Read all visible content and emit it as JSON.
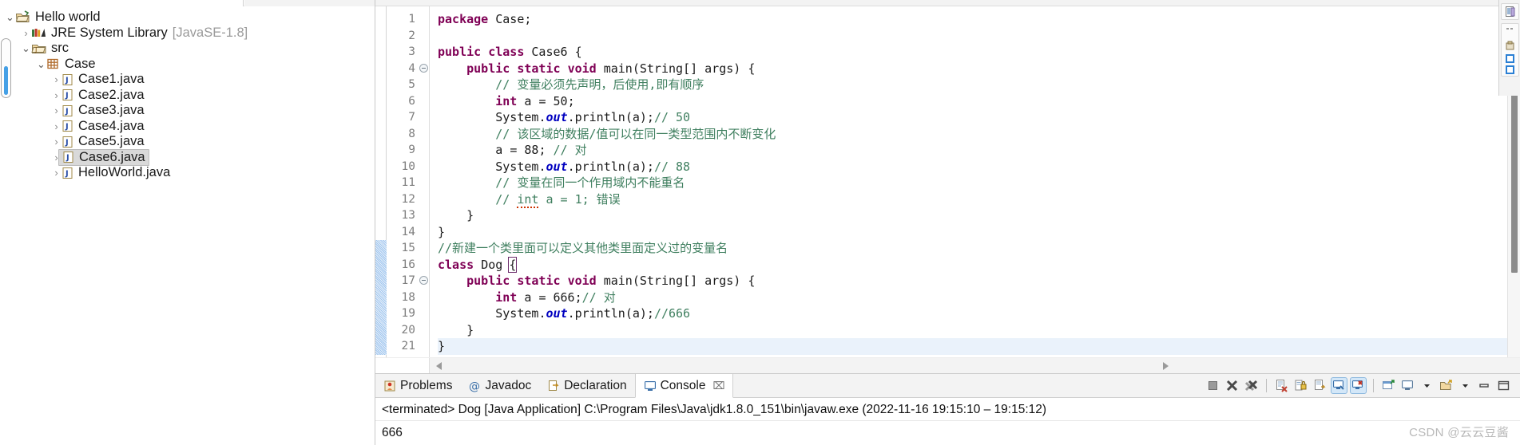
{
  "explorer": {
    "name": "package-explorer",
    "tree": [
      {
        "label": "Hello world",
        "icon": "project-open-icon",
        "arrow": "v",
        "indent": 0,
        "selected": false,
        "suffix": ""
      },
      {
        "label": "JRE System Library",
        "icon": "library-icon",
        "arrow": ">",
        "indent": 1,
        "selected": false,
        "suffix": "[JavaSE-1.8]"
      },
      {
        "label": "src",
        "icon": "source-folder-icon",
        "arrow": "v",
        "indent": 1,
        "selected": false,
        "suffix": ""
      },
      {
        "label": "Case",
        "icon": "package-icon",
        "arrow": "v",
        "indent": 2,
        "selected": false,
        "suffix": ""
      },
      {
        "label": "Case1.java",
        "icon": "java-file-icon",
        "arrow": ">",
        "indent": 3,
        "selected": false,
        "suffix": ""
      },
      {
        "label": "Case2.java",
        "icon": "java-file-icon",
        "arrow": ">",
        "indent": 3,
        "selected": false,
        "suffix": ""
      },
      {
        "label": "Case3.java",
        "icon": "java-file-icon",
        "arrow": ">",
        "indent": 3,
        "selected": false,
        "suffix": ""
      },
      {
        "label": "Case4.java",
        "icon": "java-file-icon",
        "arrow": ">",
        "indent": 3,
        "selected": false,
        "suffix": ""
      },
      {
        "label": "Case5.java",
        "icon": "java-file-icon",
        "arrow": ">",
        "indent": 3,
        "selected": false,
        "suffix": ""
      },
      {
        "label": "Case6.java",
        "icon": "java-file-icon",
        "arrow": ">",
        "indent": 3,
        "selected": true,
        "suffix": ""
      },
      {
        "label": "HelloWorld.java",
        "icon": "java-file-icon",
        "arrow": ">",
        "indent": 3,
        "selected": false,
        "suffix": ""
      }
    ]
  },
  "editor": {
    "name": "java-editor",
    "first_line": 1,
    "last_line": 21,
    "selection_block": {
      "from": 15,
      "to": 21
    },
    "lines": [
      {
        "n": 1,
        "fold": false,
        "hl": false,
        "text": "package Case;"
      },
      {
        "n": 2,
        "fold": false,
        "hl": false,
        "text": ""
      },
      {
        "n": 3,
        "fold": false,
        "hl": false,
        "text": "public class Case6 {"
      },
      {
        "n": 4,
        "fold": true,
        "hl": false,
        "text": "    public static void main(String[] args) {"
      },
      {
        "n": 5,
        "fold": false,
        "hl": false,
        "text": "        // 变量必须先声明，后使用,即有顺序"
      },
      {
        "n": 6,
        "fold": false,
        "hl": false,
        "text": "        int a = 50;"
      },
      {
        "n": 7,
        "fold": false,
        "hl": false,
        "text": "        System.out.println(a);// 50"
      },
      {
        "n": 8,
        "fold": false,
        "hl": false,
        "text": "        // 该区域的数据/值可以在同一类型范围内不断变化"
      },
      {
        "n": 9,
        "fold": false,
        "hl": false,
        "text": "        a = 88; // 对"
      },
      {
        "n": 10,
        "fold": false,
        "hl": false,
        "text": "        System.out.println(a);// 88"
      },
      {
        "n": 11,
        "fold": false,
        "hl": false,
        "text": "        // 变量在同一个作用域内不能重名"
      },
      {
        "n": 12,
        "fold": false,
        "hl": false,
        "text": "        // int a = 1; 错误"
      },
      {
        "n": 13,
        "fold": false,
        "hl": false,
        "text": "    }"
      },
      {
        "n": 14,
        "fold": false,
        "hl": false,
        "text": "}"
      },
      {
        "n": 15,
        "fold": false,
        "hl": false,
        "text": "//新建一个类里面可以定义其他类里面定义过的变量名"
      },
      {
        "n": 16,
        "fold": false,
        "hl": false,
        "text": "class Dog {"
      },
      {
        "n": 17,
        "fold": true,
        "hl": false,
        "text": "    public static void main(String[] args) {"
      },
      {
        "n": 18,
        "fold": false,
        "hl": false,
        "text": "        int a = 666;// 对"
      },
      {
        "n": 19,
        "fold": false,
        "hl": false,
        "text": "        System.out.println(a);//666"
      },
      {
        "n": 20,
        "fold": false,
        "hl": false,
        "text": "    }"
      },
      {
        "n": 21,
        "fold": false,
        "hl": true,
        "text": "}"
      }
    ]
  },
  "console": {
    "tabs": [
      {
        "label": "Problems",
        "icon": "problems-icon",
        "active": false,
        "closable": false
      },
      {
        "label": "Javadoc",
        "icon": "javadoc-icon",
        "active": false,
        "closable": false
      },
      {
        "label": "Declaration",
        "icon": "declaration-icon",
        "active": false,
        "closable": false
      },
      {
        "label": "Console",
        "icon": "console-icon",
        "active": true,
        "closable": true
      }
    ],
    "close_glyph": "⌧",
    "toolbar": [
      {
        "icon": "terminate-icon",
        "toggled": false
      },
      {
        "icon": "remove-launch-icon",
        "toggled": false
      },
      {
        "icon": "remove-all-launches-icon",
        "toggled": false
      },
      {
        "icon": "separator",
        "toggled": false
      },
      {
        "icon": "clear-console-icon",
        "toggled": false
      },
      {
        "icon": "scroll-lock-icon",
        "toggled": false
      },
      {
        "icon": "word-wrap-icon",
        "toggled": false
      },
      {
        "icon": "show-console-on-output-icon",
        "toggled": true
      },
      {
        "icon": "show-console-on-error-icon",
        "toggled": true
      },
      {
        "icon": "separator2",
        "toggled": false
      },
      {
        "icon": "pin-console-icon",
        "toggled": false
      },
      {
        "icon": "display-selected-console-icon",
        "toggled": false
      },
      {
        "icon": "dropdown-1-icon",
        "toggled": false
      },
      {
        "icon": "open-console-icon",
        "toggled": false
      },
      {
        "icon": "dropdown-2-icon",
        "toggled": false
      },
      {
        "icon": "minimize-icon",
        "toggled": false
      },
      {
        "icon": "maximize-icon",
        "toggled": false
      }
    ],
    "header": "<terminated> Dog [Java Application] C:\\Program Files\\Java\\jdk1.8.0_151\\bin\\javaw.exe  (2022-11-16 19:15:10 – 19:15:12)",
    "output": "666"
  },
  "watermark": "CSDN @云云豆酱",
  "colors": {
    "keyword": "#7f0055",
    "comment": "#3f7f5f",
    "field": "#0000c0",
    "selection_block": "#9fc6ef",
    "tab_active_bg": "#ffffff",
    "panel_bg": "#f3f3f3",
    "tree_selected_bg": "#d9d9d9"
  }
}
